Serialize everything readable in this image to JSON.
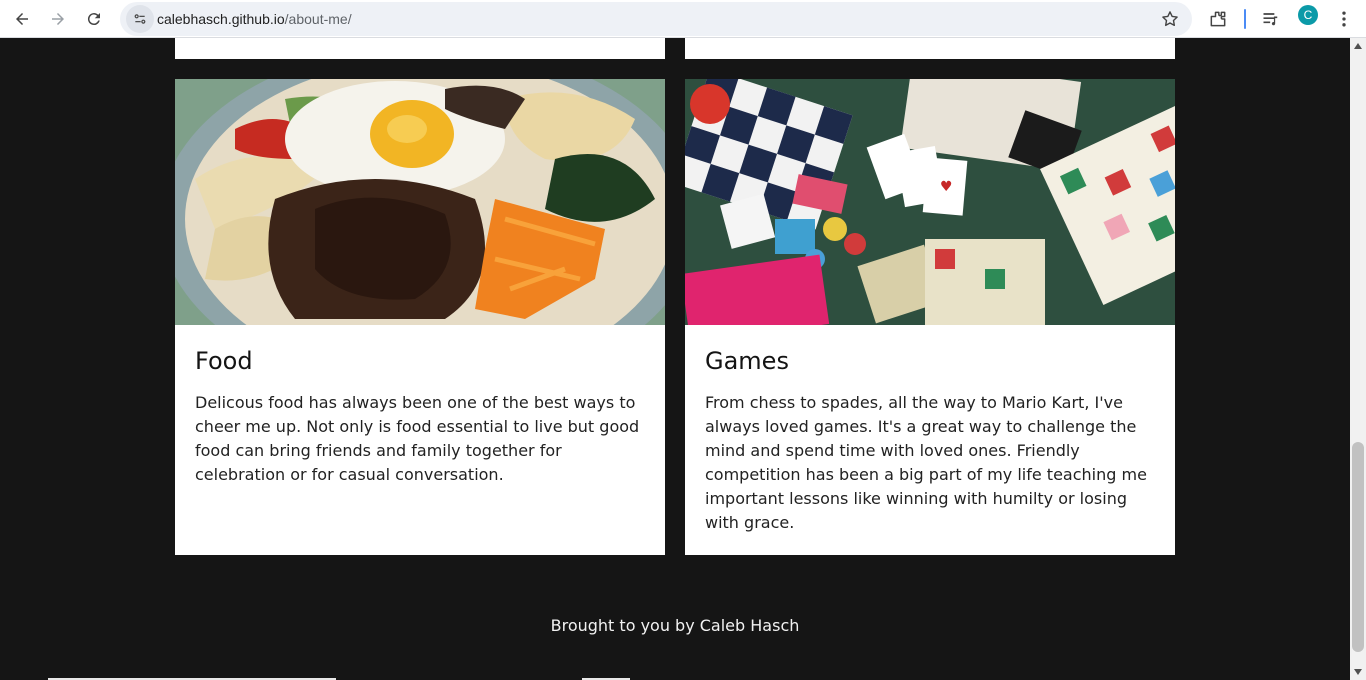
{
  "browser": {
    "url_host": "calebhasch.github.io",
    "url_path": "/about-me/",
    "profile_initial": "C",
    "icons": [
      "back-icon",
      "forward-icon",
      "reload-icon",
      "site-info-icon",
      "bookmark-star-icon",
      "extensions-icon",
      "media-controls-icon",
      "kebab-menu-icon"
    ]
  },
  "cards": [
    {
      "title": "Food",
      "body": "Delicous food has always been one of the best ways to cheer me up. Not only is food essential to live but good food can bring friends and family together for celebration or for casual conversation.",
      "image": "bibimbap-photo"
    },
    {
      "title": "Games",
      "body": "From chess to spades, all the way to Mario Kart, I've always loved games. It's a great way to challenge the mind and spend time with loved ones. Friendly competition has been a big part of my life teaching me important lessons like winning with humilty or losing with grace.",
      "image": "board-games-photo"
    }
  ],
  "footer": {
    "text": "Brought to you by Caleb Hasch"
  },
  "colors": {
    "page_background": "#151515",
    "card_background": "#ffffff",
    "footer_text": "#f2f2f2"
  }
}
